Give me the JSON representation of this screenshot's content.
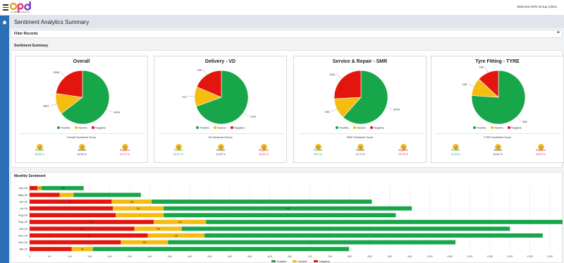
{
  "header": {
    "welcome": "Welcome NFD Group Admin",
    "logo_tag": "GLOBAL RESEARCH"
  },
  "page": {
    "title": "Sentiment Analytics Summary"
  },
  "filter": {
    "label": "Filter Records",
    "expand": "+"
  },
  "summary": {
    "label": "Sentiment Summary"
  },
  "legend": {
    "positive": "Positive",
    "neutral": "Neutral",
    "negative": "Negative"
  },
  "colors": {
    "positive": "#18a64a",
    "neutral": "#f5bd10",
    "negative": "#e3160f",
    "accent": "#2d6fb5"
  },
  "cards": [
    {
      "title": "Overall",
      "positive": 9464,
      "neutral": 1861,
      "negative": 3328,
      "pie_labels": {
        "positive": "9464",
        "neutral": "1861",
        "negative": "3328"
      },
      "score_title": "Overall Sentiment Score",
      "score_labels": {
        "positive": "Positive",
        "neutral": "Neutral",
        "negative": "Negative"
      },
      "scores": {
        "positive": "65.06 %",
        "neutral": "12.53 %",
        "negative": "22.41 %"
      }
    },
    {
      "title": "Delivery - VD",
      "positive": 1232,
      "neutral": 212,
      "negative": 330,
      "pie_labels": {
        "positive": "1232",
        "neutral": "212",
        "negative": "330"
      },
      "score_title": "VD Sentiment Score",
      "score_labels": {
        "positive": "Positive",
        "neutral": "Neutral",
        "negative": "Negative"
      },
      "scores": {
        "positive": "69.37 %",
        "neutral": "11.92 %",
        "negative": "18.91 %"
      }
    },
    {
      "title": "Service & Repair - SMR",
      "positive": 3434,
      "neutral": 696,
      "negative": 1441,
      "pie_labels": {
        "positive": "3434",
        "neutral": "696",
        "negative": "1441"
      },
      "score_title": "SMR Sentiment Score",
      "score_labels": {
        "positive": "Positive",
        "neutral": "Neutral",
        "negative": "Negative"
      },
      "scores": {
        "positive": "62.5 %",
        "neutral": "11.71 %",
        "negative": "25.79 %"
      }
    },
    {
      "title": "Tyre Fitting - TYRE",
      "positive": 962,
      "neutral": 138,
      "negative": 165,
      "pie_labels": {
        "positive": "962",
        "neutral": "138",
        "negative": "165"
      },
      "score_title": "TYRE Sentiment Score",
      "score_labels": {
        "positive": "Positive",
        "neutral": "Neutral",
        "negative": "Negative"
      },
      "scores": {
        "positive": "74.29 %",
        "neutral": "10.64 %",
        "negative": "15.04 %"
      }
    }
  ],
  "monthly": {
    "label": "Monthly Sentiment"
  },
  "chart_data": {
    "type": "bar",
    "orientation": "horizontal",
    "stacked": true,
    "categories": [
      "Apr-20",
      "May-20",
      "Jun-20",
      "Jul-20",
      "Aug-20",
      "Sep-20",
      "Oct-20",
      "Nov-20",
      "Dec-20",
      "Jan-21"
    ],
    "series": [
      {
        "name": "Negative",
        "color": "#e3160f",
        "values": [
          20,
          75,
          205,
          208,
          215,
          310,
          262,
          295,
          228,
          105
        ]
      },
      {
        "name": "Neutral",
        "color": "#f5bd10",
        "values": [
          10,
          35,
          100,
          127,
          120,
          131,
          118,
          142,
          118,
          53
        ]
      },
      {
        "name": "Positive",
        "color": "#18a64a",
        "values": [
          105,
          168,
          550,
          620,
          580,
          915,
          820,
          845,
          718,
          640
        ]
      }
    ],
    "data_labels": {
      "Negative": [
        "1··",
        "··",
        "207",
        "···",
        "···",
        "313",
        "262",
        "291",
        "···",
        "···"
      ],
      "Neutral": [
        "18",
        "··",
        "118",
        "127",
        "···",
        "131",
        "118",
        "142",
        "118",
        "53"
      ],
      "Positive": [
        "128",
        "···",
        "···",
        "618",
        "···",
        "···",
        "···",
        "···",
        "···",
        "···"
      ]
    },
    "xlim": [
      0,
      1300
    ],
    "xticks": [
      0,
      50,
      100,
      150,
      200,
      250,
      300,
      350,
      400,
      450,
      500,
      550,
      600,
      650,
      700,
      750,
      800,
      850,
      900,
      950,
      1000,
      1050,
      1100,
      1150,
      1200,
      1250,
      1300
    ],
    "grid": true,
    "legend": "bottom"
  }
}
